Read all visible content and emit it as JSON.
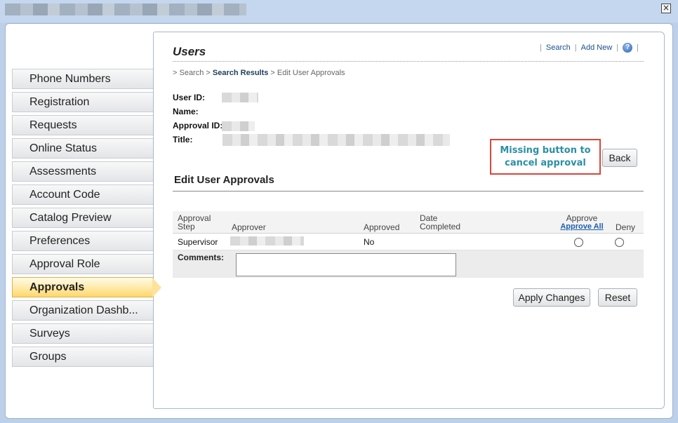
{
  "window": {
    "close_icon": "close-icon"
  },
  "sidebar": {
    "items": [
      {
        "label": "Phone Numbers"
      },
      {
        "label": "Registration"
      },
      {
        "label": "Requests"
      },
      {
        "label": "Online Status"
      },
      {
        "label": "Assessments"
      },
      {
        "label": "Account Code"
      },
      {
        "label": "Catalog Preview"
      },
      {
        "label": "Preferences"
      },
      {
        "label": "Approval Role"
      },
      {
        "label": "Approvals",
        "active": true
      },
      {
        "label": "Organization Dashb..."
      },
      {
        "label": "Surveys"
      },
      {
        "label": "Groups"
      }
    ]
  },
  "header": {
    "title": "Users",
    "links": {
      "search": "Search",
      "add_new": "Add New",
      "help_icon": "help-icon"
    }
  },
  "breadcrumb": {
    "prefix": "> ",
    "first": "Search",
    "sep": " > ",
    "second": "Search Results",
    "third": "Edit User Approvals"
  },
  "info": {
    "user_id_label": "User ID:",
    "name_label": "Name:",
    "approval_id_label": "Approval ID:",
    "title_label": "Title:"
  },
  "annotation": {
    "line1": "Missing button to",
    "line2": "cancel approval"
  },
  "buttons": {
    "back": "Back",
    "apply": "Apply Changes",
    "reset": "Reset"
  },
  "section": {
    "title": "Edit User Approvals"
  },
  "table": {
    "headers": {
      "step_line1": "Approval",
      "step_line2": "Step",
      "approver": "Approver",
      "approved": "Approved",
      "date_line1": "Date",
      "date_line2": "Completed",
      "approve": "Approve",
      "approve_all": "Approve All",
      "deny": "Deny"
    },
    "rows": [
      {
        "step": "Supervisor",
        "approved": "No"
      }
    ],
    "comments_label": "Comments:"
  }
}
